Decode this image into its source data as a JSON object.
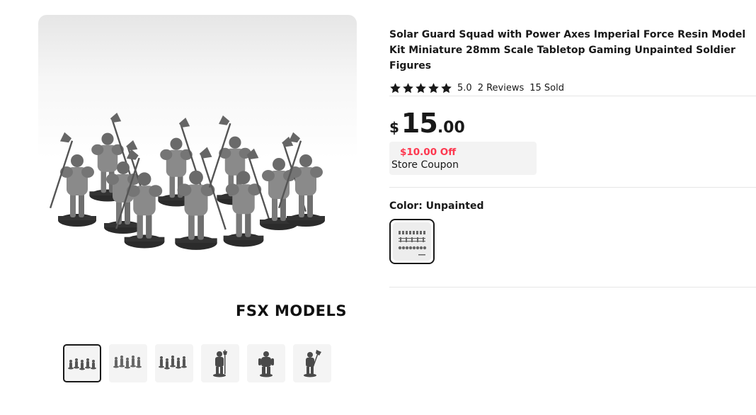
{
  "product": {
    "title": "Solar Guard Squad with Power Axes Imperial Force Resin Model Kit Miniature 28mm Scale Tabletop Gaming Unpainted Soldier Figures",
    "rating_value": "5.0",
    "stars": 5,
    "reviews": "2 Reviews",
    "sold": "15 Sold"
  },
  "price": {
    "currency": "$",
    "integer": "15",
    "decimal": ".00"
  },
  "coupon": {
    "discount": "$10.00 Off",
    "label": "Store Coupon"
  },
  "color": {
    "label": "Color: Unpainted"
  },
  "gallery": {
    "watermark": "FSX MODELS",
    "thumbnail_count": 6,
    "active_index": 0
  },
  "colors": {
    "text": "#191919",
    "coupon_red": "#fd384f",
    "coupon_bg": "#f3f3f3",
    "divider": "#e6e6e6"
  }
}
